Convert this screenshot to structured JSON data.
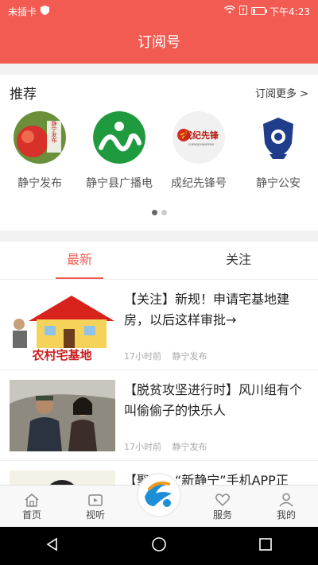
{
  "statusbar": {
    "carrier": "未插卡",
    "time": "下午4:23",
    "battery_level": 0.2
  },
  "header": {
    "title": "订阅号"
  },
  "recommend": {
    "title": "推荐",
    "more": "订阅更多 >",
    "items": [
      {
        "name": "静宁发布",
        "logo_text": "静宁发布"
      },
      {
        "name": "静宁县广播电"
      },
      {
        "name": "成纪先锋号",
        "logo_text": "成纪先锋",
        "logo_subtext": "CHENGJIXIANFENG"
      },
      {
        "name": "静宁公安"
      }
    ]
  },
  "tabs": [
    {
      "label": "最新"
    },
    {
      "label": "关注"
    }
  ],
  "news": [
    {
      "title": "【关注】新规！申请宅基地建房，以后这样审批→",
      "time": "17小时前",
      "source": "静宁发布",
      "thumb_text": "农村宅基地"
    },
    {
      "title": "【脱贫攻坚进行时】风川组有个叫偷偷子的快乐人",
      "time": "17小时前",
      "source": "静宁发布"
    },
    {
      "title": "【聚焦】“新静宁”手机APP正"
    }
  ],
  "bottom_nav": [
    {
      "label": "首页",
      "icon": "home-icon"
    },
    {
      "label": "视听",
      "icon": "video-icon"
    },
    {
      "label": "",
      "icon": "app-logo-icon"
    },
    {
      "label": "服务",
      "icon": "heart-icon"
    },
    {
      "label": "我的",
      "icon": "user-icon"
    }
  ],
  "colors": {
    "brand": "#f15b52",
    "background": "#f2f2f2"
  }
}
